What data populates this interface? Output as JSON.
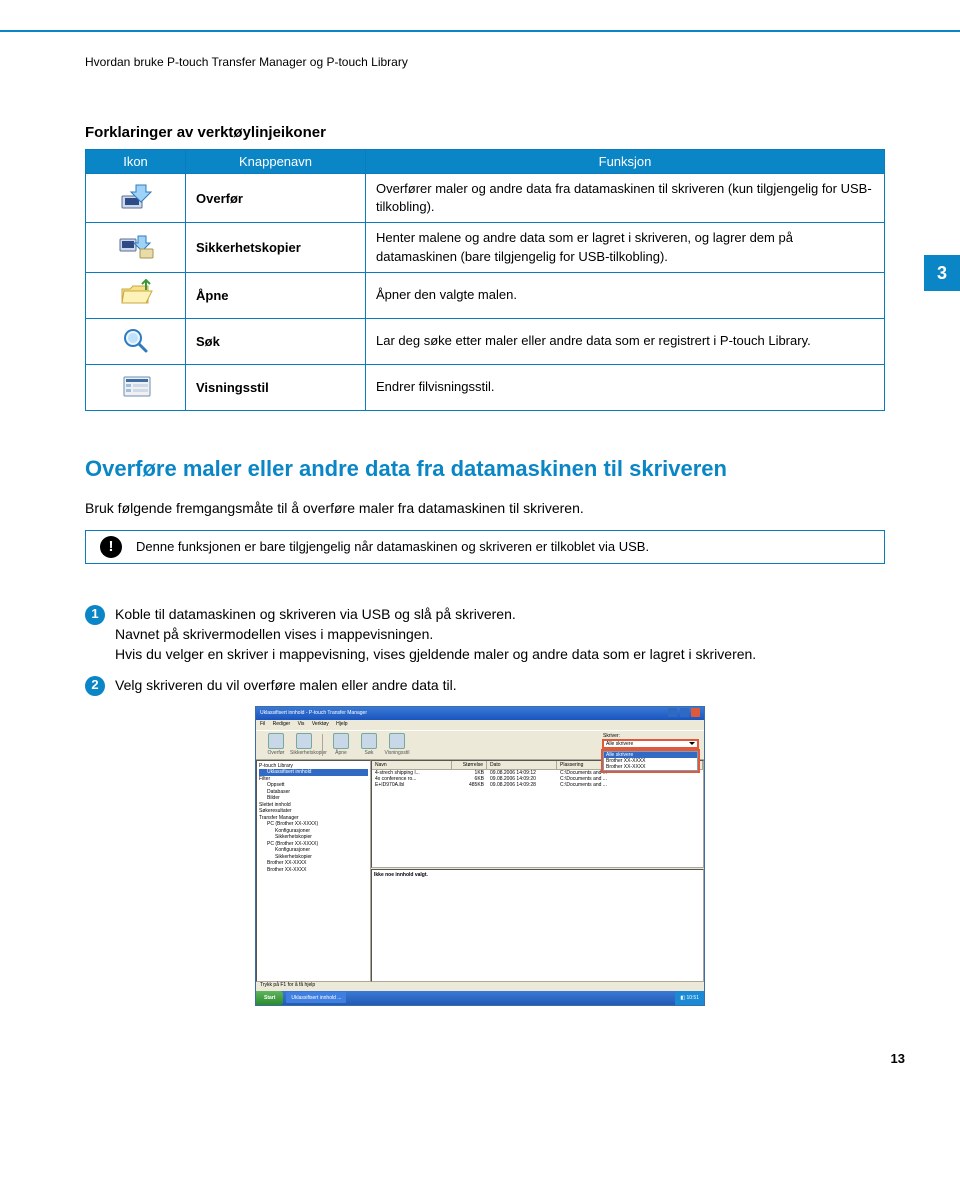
{
  "chapter_tab": "3",
  "page_number": "13",
  "breadcrumb": "Hvordan bruke P-touch Transfer Manager og P-touch Library",
  "table_title": "Forklaringer av verktøylinjeikoner",
  "headers": {
    "icon": "Ikon",
    "name": "Knappenavn",
    "func": "Funksjon"
  },
  "rows": [
    {
      "name": "Overfør",
      "func": "Overfører maler og andre data fra datamaskinen til skriveren (kun tilgjengelig for USB-tilkobling)."
    },
    {
      "name": "Sikkerhetskopier",
      "func": "Henter malene og andre data som er lagret i skriveren, og lagrer dem på datamaskinen (bare tilgjengelig for USB-tilkobling)."
    },
    {
      "name": "Åpne",
      "func": "Åpner den valgte malen."
    },
    {
      "name": "Søk",
      "func": "Lar deg søke etter maler eller andre data som er registrert i P-touch Library."
    },
    {
      "name": "Visningsstil",
      "func": "Endrer filvisningsstil."
    }
  ],
  "section_heading": "Overføre maler eller andre data fra datamaskinen til skriveren",
  "section_intro": "Bruk følgende fremgangsmåte til å overføre maler fra datamaskinen til skriveren.",
  "note_text": "Denne funksjonen er bare tilgjengelig når datamaskinen og skriveren er tilkoblet via USB.",
  "steps": {
    "s1_line1": "Koble til datamaskinen og skriveren via USB og slå på skriveren.",
    "s1_line2": "Navnet på skrivermodellen vises i mappevisningen.",
    "s1_line3": "Hvis du velger en skriver i mappevisning, vises gjeldende maler og andre data som er lagret i skriveren.",
    "s2": "Velg skriveren du vil overføre malen eller andre data til."
  },
  "shot": {
    "title": "Uklassifisert innhold - P-touch Transfer Manager",
    "menu": [
      "Fil",
      "Rediger",
      "Vis",
      "Verktøy",
      "Hjelp"
    ],
    "tools": [
      "Overfør",
      "Sikkerhetskopier",
      "Åpne",
      "Søk",
      "Visningsstil"
    ],
    "printer_label": "Skriver:",
    "printer_options": [
      "Alle skrivere",
      "Brother XX-XXXX",
      "Brother XX-XXXX"
    ],
    "tree": [
      "P-touch Library",
      "  Uklassifisert innhold",
      "Filter",
      "  Oppsett",
      "  Databaser",
      "  Bilder",
      "Slettet innhold",
      "Søkeresultater",
      "Transfer Manager",
      "  PC (Brother XX-XXXX)",
      "    Konfigurasjoner",
      "    Sikkerhetskopier",
      "  PC (Brother XX-XXXX)",
      "    Konfigurasjoner",
      "    Sikkerhetskopier",
      "  Brother XX-XXXX",
      "  Brother XX-XXXX"
    ],
    "list_headers": [
      "Navn",
      "Størrelse",
      "Dato",
      "Plassering"
    ],
    "list_rows": [
      [
        "4-strech shipping l...",
        "1KB",
        "09.08.2006 14:09:12",
        "C:\\Documents and ..."
      ],
      [
        "4x conference ro...",
        "6KB",
        "09.08.2006 14:09:20",
        "C:\\Documents and ..."
      ],
      [
        "E+ID970A.lbl",
        "485KB",
        "09.08.2006 14:09:28",
        "C:\\Documents and ..."
      ]
    ],
    "preview_msg": "Ikke noe innhold valgt.",
    "status": "Trykk på F1 for å få hjelp",
    "start": "Start",
    "task": "Uklassifisert innhold ...",
    "clock": "10:51"
  }
}
